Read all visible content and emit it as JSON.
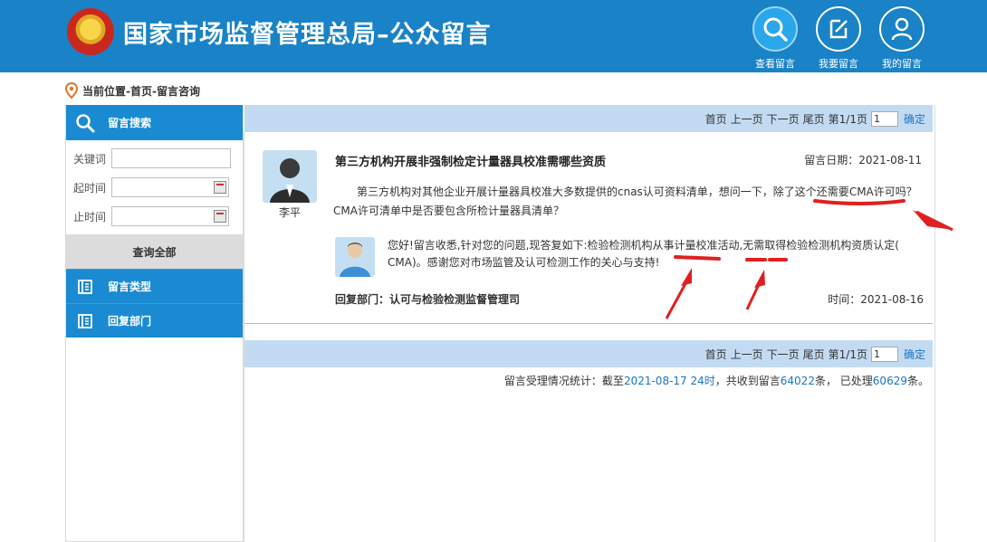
{
  "header": {
    "title": "国家市场监督管理总局–公众留言",
    "buttons": [
      {
        "label": "查看留言",
        "icon": "search-icon"
      },
      {
        "label": "我要留言",
        "icon": "edit-icon"
      },
      {
        "label": "我的留言",
        "icon": "user-icon"
      }
    ]
  },
  "breadcrumb": "当前位置-首页-留言咨询",
  "sidebar": {
    "search_title": "留言搜索",
    "keyword_label": "关键词",
    "start_label": "起时间",
    "end_label": "止时间",
    "query_all": "查询全部",
    "items": [
      {
        "label": "留言类型",
        "icon": "book-icon"
      },
      {
        "label": "回复部门",
        "icon": "book-icon"
      }
    ]
  },
  "pager": {
    "first": "首页",
    "prev": "上一页",
    "next": "下一页",
    "last": "尾页",
    "page_info": "第1/1页",
    "page_input": "1",
    "confirm": "确定"
  },
  "message": {
    "author": "李平",
    "title": "第三方机构开展非强制检定计量器具校准需哪些资质",
    "date": "留言日期：2021-08-11",
    "body": "第三方机构对其他企业开展计量器具校准大多数提供的cnas认可资料清单，想问一下，除了这个还需要CMA许可吗？CMA许可清单中是否要包含所检计量器具清单？",
    "reply": "您好!留言收悉,针对您的问题,现答复如下:检验检测机构从事计量校准活动,无需取得检验检测机构资质认定( CMA)。感谢您对市场监管及认可检测工作的关心与支持!",
    "reply_dept": "回复部门：认可与检验检测监督管理司",
    "reply_time": "时间：2021-08-16"
  },
  "stats": {
    "prefix": "留言受理情况统计：截至",
    "date": "2021-08-17 24时",
    "mid1": "，共收到留言",
    "received": "64022",
    "mid2": "条，  已处理",
    "processed": "60629",
    "suffix": "条。"
  },
  "colors": {
    "header_bg": "#1a82c6",
    "sidebar_blue": "#1a8bd2",
    "pager_bg": "#c3dbf2",
    "link_blue": "#1a75c2",
    "annotation_red": "#e02020"
  }
}
